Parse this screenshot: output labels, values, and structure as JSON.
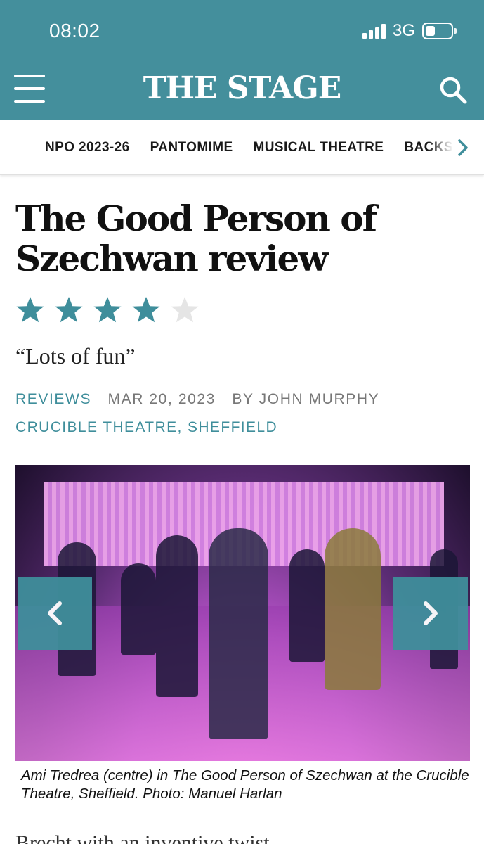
{
  "status_bar": {
    "time": "08:02",
    "network": "3G"
  },
  "header": {
    "logo": "THE STAGE"
  },
  "nav": {
    "categories": [
      "NPO 2023-26",
      "PANTOMIME",
      "MUSICAL THEATRE",
      "BACKSTAGE"
    ]
  },
  "article": {
    "title": "The Good Person of Szechwan review",
    "rating": 4,
    "rating_max": 5,
    "pull_quote": "“Lots of fun”",
    "section": "REVIEWS",
    "date": "MAR 20, 2023",
    "byline": "BY JOHN MURPHY",
    "venue": "CRUCIBLE THEATRE, SHEFFIELD",
    "caption": "Ami Tredrea (centre) in The Good Person of Szechwan at the Crucible Theatre, Sheffield. Photo: Manuel Harlan",
    "teaser": "Brecht with an inventive twist"
  },
  "colors": {
    "brand": "#448f9c",
    "accent": "#3f8e9b",
    "star_empty": "#e5e5e5"
  },
  "icons": {
    "menu": "hamburger-icon",
    "search": "search-icon",
    "nav_next": "chevron-right-icon",
    "prev": "chevron-left-icon",
    "next": "chevron-right-icon",
    "star": "star-icon"
  }
}
